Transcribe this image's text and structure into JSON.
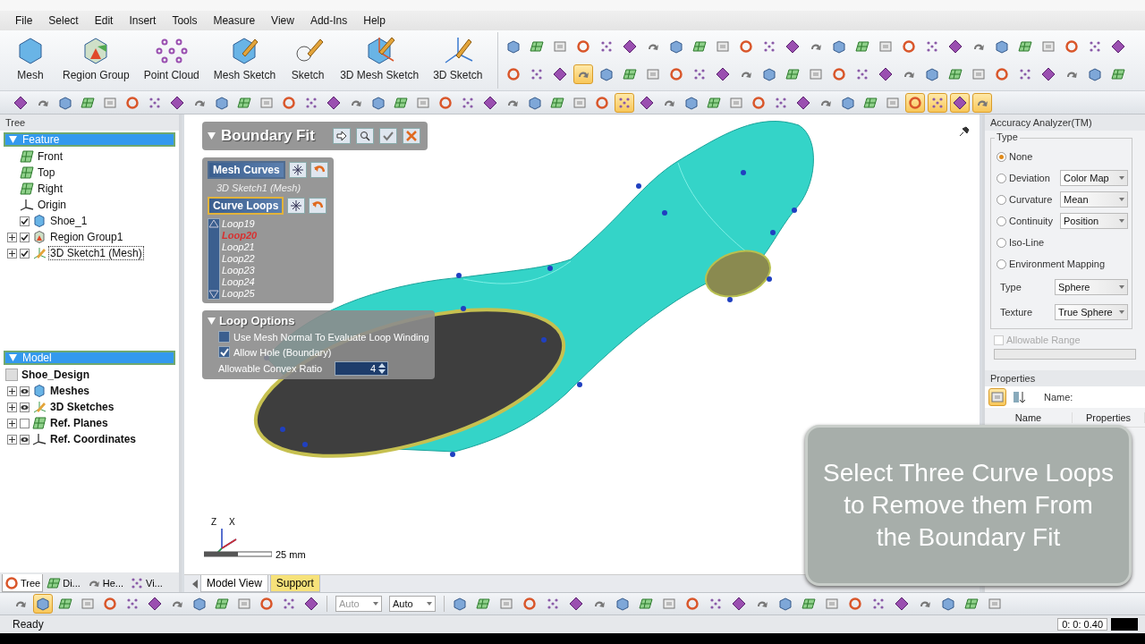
{
  "menu": [
    "File",
    "Select",
    "Edit",
    "Insert",
    "Tools",
    "Measure",
    "View",
    "Add-Ins",
    "Help"
  ],
  "ribbon": {
    "large_buttons": [
      {
        "label": "Mesh",
        "kind": "mesh"
      },
      {
        "label": "Region Group",
        "kind": "region"
      },
      {
        "label": "Point Cloud",
        "kind": "points"
      },
      {
        "label": "Mesh Sketch",
        "kind": "mesh_sketch"
      },
      {
        "label": "Sketch",
        "kind": "sketch"
      },
      {
        "label": "3D Mesh Sketch",
        "kind": "mesh_sketch3d"
      },
      {
        "label": "3D Sketch",
        "kind": "sketch3d"
      }
    ],
    "small_rows": [
      [
        {
          "selected": false
        },
        {
          "selected": false
        },
        {
          "selected": false
        },
        {
          "selected": false
        },
        {
          "selected": false
        },
        {
          "selected": false
        },
        {
          "selected": false
        },
        {
          "selected": false
        },
        {
          "selected": false
        },
        {
          "selected": false
        },
        {
          "selected": false
        },
        {
          "selected": false
        },
        {
          "selected": false
        },
        {
          "selected": false
        },
        {
          "selected": false
        },
        {
          "selected": false
        },
        {
          "selected": false
        },
        {
          "selected": false
        },
        {
          "selected": false
        },
        {
          "selected": false
        },
        {
          "selected": false
        },
        {
          "selected": false
        },
        {
          "selected": false
        },
        {
          "selected": false
        },
        {
          "selected": false
        },
        {
          "selected": false
        },
        {
          "selected": false
        }
      ],
      [
        {
          "selected": false
        },
        {
          "selected": false
        },
        {
          "selected": false
        },
        {
          "selected": true
        },
        {
          "selected": false
        },
        {
          "selected": false
        },
        {
          "selected": false
        },
        {
          "selected": false
        },
        {
          "selected": false
        },
        {
          "selected": false
        },
        {
          "selected": false
        },
        {
          "selected": false
        },
        {
          "selected": false
        },
        {
          "selected": false
        },
        {
          "selected": false
        },
        {
          "selected": false
        },
        {
          "selected": false
        },
        {
          "selected": false
        },
        {
          "selected": false
        },
        {
          "selected": false
        },
        {
          "selected": false
        },
        {
          "selected": false
        },
        {
          "selected": false
        },
        {
          "selected": false
        },
        {
          "selected": false
        },
        {
          "selected": false
        },
        {
          "selected": false
        }
      ]
    ]
  },
  "main_toolbar": [
    {
      "selected": false
    },
    {
      "selected": false
    },
    {
      "selected": false
    },
    {
      "selected": false
    },
    {
      "selected": false
    },
    {
      "selected": false
    },
    {
      "selected": false
    },
    {
      "selected": false
    },
    {
      "selected": false
    },
    {
      "selected": false
    },
    {
      "selected": false
    },
    {
      "selected": false
    },
    {
      "selected": false
    },
    {
      "selected": false
    },
    {
      "selected": false
    },
    {
      "selected": false
    },
    {
      "selected": false
    },
    {
      "selected": false
    },
    {
      "selected": false
    },
    {
      "selected": false
    },
    {
      "selected": false
    },
    {
      "selected": false
    },
    {
      "selected": false
    },
    {
      "selected": false
    },
    {
      "selected": false
    },
    {
      "selected": false
    },
    {
      "selected": false
    },
    {
      "selected": true
    },
    {
      "selected": false
    },
    {
      "selected": false
    },
    {
      "selected": false
    },
    {
      "selected": false
    },
    {
      "selected": false
    },
    {
      "selected": false
    },
    {
      "selected": false
    },
    {
      "selected": false
    },
    {
      "selected": false
    },
    {
      "selected": false
    },
    {
      "selected": false
    },
    {
      "selected": false
    },
    {
      "selected": true
    },
    {
      "selected": true
    },
    {
      "selected": true
    },
    {
      "selected": true
    }
  ],
  "tree": {
    "title": "Tree",
    "feature": {
      "title": "Feature",
      "items": [
        {
          "label": "Front",
          "kind": "plane"
        },
        {
          "label": "Top",
          "kind": "plane"
        },
        {
          "label": "Right",
          "kind": "plane"
        },
        {
          "label": "Origin",
          "kind": "axes"
        },
        {
          "label": "Shoe_1",
          "kind": "mesh",
          "checked": true
        },
        {
          "label": "Region Group1",
          "kind": "region",
          "checked": true,
          "expanded": false
        },
        {
          "label": "3D Sketch1 (Mesh)",
          "kind": "sketch",
          "checked": true,
          "expanded": false,
          "selected": true
        }
      ]
    },
    "model": {
      "title": "Model",
      "root": "Shoe_Design",
      "children": [
        {
          "label": "Meshes",
          "kind": "mesh",
          "visible": true,
          "expanded": false
        },
        {
          "label": "3D Sketches",
          "kind": "sketch",
          "visible": true,
          "expanded": false
        },
        {
          "label": "Ref. Planes",
          "kind": "plane",
          "visible": false,
          "expanded": false
        },
        {
          "label": "Ref. Coordinates",
          "kind": "axes",
          "visible": true,
          "expanded": false
        }
      ]
    },
    "tabs": [
      {
        "label": "Tree",
        "selected": true
      },
      {
        "label": "Di...",
        "selected": false
      },
      {
        "label": "He...",
        "selected": false
      },
      {
        "label": "Vi...",
        "selected": false
      }
    ]
  },
  "boundary_fit": {
    "title": "Boundary Fit",
    "mesh_curves": {
      "label": "Mesh Curves",
      "active": false,
      "item": "3D Sketch1 (Mesh)"
    },
    "curve_loops": {
      "label": "Curve Loops",
      "active": true,
      "items": [
        {
          "label": "Loop19",
          "selected": false
        },
        {
          "label": "Loop20",
          "selected": true
        },
        {
          "label": "Loop21",
          "selected": false
        },
        {
          "label": "Loop22",
          "selected": false
        },
        {
          "label": "Loop23",
          "selected": false
        },
        {
          "label": "Loop24",
          "selected": false
        },
        {
          "label": "Loop25",
          "selected": false
        }
      ]
    },
    "loop_options": {
      "title": "Loop Options",
      "checks": [
        {
          "label": "Use Mesh Normal To Evaluate Loop Winding",
          "checked": false
        },
        {
          "label": "Allow Hole (Boundary)",
          "checked": true
        }
      ],
      "ratio_label": "Allowable Convex Ratio",
      "ratio_value": "4"
    }
  },
  "viewport": {
    "axis_labels": [
      "Z",
      "X"
    ],
    "scale": "25 mm",
    "tabs": [
      {
        "label": "Model View",
        "selected": false
      },
      {
        "label": "Support",
        "selected": true
      }
    ]
  },
  "accuracy_analyzer": {
    "title": "Accuracy Analyzer(TM)",
    "group": "Type",
    "options": [
      {
        "label": "None",
        "selected": true
      },
      {
        "label": "Deviation",
        "selected": false,
        "value": "Color Map"
      },
      {
        "label": "Curvature",
        "selected": false,
        "value": "Mean"
      },
      {
        "label": "Continuity",
        "selected": false,
        "value": "Position"
      },
      {
        "label": "Iso-Line",
        "selected": false
      },
      {
        "label": "Environment Mapping",
        "selected": false
      }
    ],
    "settings": [
      {
        "label": "Type",
        "value": "Sphere"
      },
      {
        "label": "Texture",
        "value": "True Sphere"
      }
    ],
    "range": {
      "label": "Allowable Range",
      "checked": false,
      "disabled": true
    }
  },
  "properties": {
    "title": "Properties",
    "name_label": "Name:",
    "columns": [
      "Name",
      "Properties"
    ]
  },
  "caption": "Select Three Curve Loops to Remove them From the Boundary Fit",
  "bottom_toolbar": {
    "left": [
      {
        "selected": false
      },
      {
        "selected": true
      },
      {
        "selected": false
      },
      {
        "selected": false
      },
      {
        "selected": false
      },
      {
        "selected": false
      },
      {
        "selected": false
      },
      {
        "selected": false
      },
      {
        "selected": false
      },
      {
        "selected": false
      },
      {
        "selected": false
      },
      {
        "selected": false
      },
      {
        "selected": false
      },
      {
        "selected": false
      }
    ],
    "dropdowns": [
      {
        "value": "Auto",
        "disabled": true
      },
      {
        "value": "Auto",
        "disabled": false
      }
    ],
    "right": [
      {
        "selected": false
      },
      {
        "selected": false
      },
      {
        "selected": false
      },
      {
        "selected": false
      },
      {
        "selected": false
      },
      {
        "selected": false
      },
      {
        "selected": false
      },
      {
        "selected": false
      },
      {
        "selected": false
      },
      {
        "selected": false
      },
      {
        "selected": false
      },
      {
        "selected": false
      },
      {
        "selected": false
      },
      {
        "selected": false
      },
      {
        "selected": false
      },
      {
        "selected": false
      },
      {
        "selected": false
      },
      {
        "selected": false
      },
      {
        "selected": false
      },
      {
        "selected": false
      },
      {
        "selected": false
      },
      {
        "selected": false
      },
      {
        "selected": false
      },
      {
        "selected": false
      }
    ]
  },
  "status": {
    "text": "Ready",
    "time": "0: 0: 0.40"
  }
}
